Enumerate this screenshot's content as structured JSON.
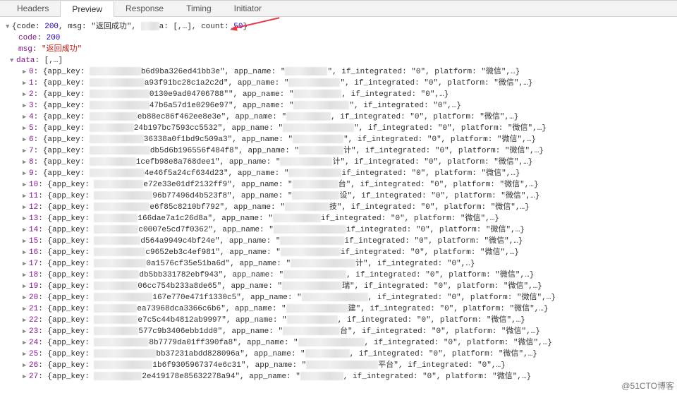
{
  "tabs": [
    {
      "label": "Headers",
      "active": false
    },
    {
      "label": "Preview",
      "active": true
    },
    {
      "label": "Response",
      "active": false
    },
    {
      "label": "Timing",
      "active": false
    },
    {
      "label": "Initiator",
      "active": false
    }
  ],
  "summary": {
    "prefix": "{code: ",
    "code": "200",
    "msg_label": ", msg: \"",
    "msg": "返回成功",
    "msg_suffix": "\", ",
    "mid_redact_text": "a: [,…]",
    "count_label": ", count: ",
    "count": "50",
    "suffix": "}"
  },
  "meta": {
    "code_key": "code",
    "code_val": "200",
    "msg_key": "msg",
    "msg_val": "\"返回成功\"",
    "data_key": "data",
    "data_val": "[,…]"
  },
  "items": [
    {
      "i": 0,
      "hash": "b6d9ba326ed41bb3e",
      "tail": "\", if_integrated: \"0\", platform: \"微信\",…}"
    },
    {
      "i": 1,
      "hash": "a93f91bc28c1a2c2d",
      "tail": "\", if_integrated: \"0\", platform: \"微信\",…}"
    },
    {
      "i": 2,
      "hash": "0130e9ad04706788\"",
      "tail": ", if_integrated: \"0\",…}"
    },
    {
      "i": 3,
      "hash": "47b6a57d1e0296e97",
      "tail": "\", if_integrated: \"0\",…}"
    },
    {
      "i": 4,
      "hash": "eb88ec86f462ee8e3e",
      "tail": ", if_integrated: \"0\", platform: \"微信\",…}"
    },
    {
      "i": 5,
      "hash": "24b197bc7593cc5532",
      "tail": "\", if_integrated: \"0\", platform: \"微信\",…}"
    },
    {
      "i": 6,
      "hash": "36338a0f1bd9c509a3",
      "tail": "\", if_integrated: \"0\", platform: \"微信\",…}"
    },
    {
      "i": 7,
      "hash": "db5d6b196556f484f8",
      "tail": "计\", if_integrated: \"0\", platform: \"微信\",…}"
    },
    {
      "i": 8,
      "hash": "1cefb98e8a768dee1",
      "tail": "计\", if_integrated: \"0\", platform: \"微信\",…}"
    },
    {
      "i": 9,
      "hash": "4e46f5a24cf634d23",
      "tail": "if_integrated: \"0\", platform: \"微信\",…}"
    },
    {
      "i": 10,
      "hash": "e72e33e01df2132ff9",
      "tail": "台\", if_integrated: \"0\", platform: \"微信\",…}"
    },
    {
      "i": 11,
      "hash": "96b77496d4b523f8",
      "tail": "设\", if_integrated: \"0\", platform: \"微信\",…}"
    },
    {
      "i": 12,
      "hash": "e6f85c8210bf792",
      "tail": "技\", if_integrated: \"0\", platform: \"微信\",…}"
    },
    {
      "i": 13,
      "hash": "166dae7a1c26d8a",
      "tail": "if_integrated: \"0\", platform: \"微信\",…}"
    },
    {
      "i": 14,
      "hash": "c0007e5cd7f0362",
      "tail": "if_integrated: \"0\", platform: \"微信\",…}"
    },
    {
      "i": 15,
      "hash": "d564a9949c4bf24e",
      "tail": "if_integrated: \"0\", platform: \"微信\",…}"
    },
    {
      "i": 16,
      "hash": "c9652eb3c4ef981",
      "tail": "if_integrated: \"0\", platform: \"微信\",…}"
    },
    {
      "i": 17,
      "hash": "0a1576cf35e51ba6d",
      "tail": "计\", if_integrated: \"0\",…}"
    },
    {
      "i": 18,
      "hash": "db5bb331782ebf943",
      "tail": ", if_integrated: \"0\", platform: \"微信\",…}"
    },
    {
      "i": 19,
      "hash": "06cc754b233a8de65",
      "tail": "瑞\", if_integrated: \"0\", platform: \"微信\",…}"
    },
    {
      "i": 20,
      "hash": "167e770e471f1330c5",
      "tail": ", if_integrated: \"0\", platform: \"微信\",…}"
    },
    {
      "i": 21,
      "hash": "ea73968dca3366c6b6",
      "tail": "建\", if_integrated: \"0\", platform: \"微信\",…}"
    },
    {
      "i": 22,
      "hash": "e7c5c44b4812ab9997",
      "tail": ", if_integrated: \"0\", platform: \"微信\",…}"
    },
    {
      "i": 23,
      "hash": "577c9b3406ebb1dd0",
      "tail": "台\", if_integrated: \"0\", platform: \"微信\",…}"
    },
    {
      "i": 24,
      "hash": "8b7779da01ff390fa8",
      "tail": ", if_integrated: \"0\", platform: \"微信\",…}"
    },
    {
      "i": 25,
      "hash": "bb37231abdd828096a",
      "tail": ", if_integrated: \"0\", platform: \"微信\",…}"
    },
    {
      "i": 26,
      "hash": "1b6f9305967374e6c31",
      "tail": "平台\", if_integrated: \"0\",…}"
    },
    {
      "i": 27,
      "hash": "2e419178e85632278a94",
      "tail": ", if_integrated: \"0\", platform: \"微信\",…}"
    }
  ],
  "labels": {
    "app_key": "{app_key: ",
    "app_name": ", app_name: \"",
    "close": "\""
  },
  "watermark": "@51CTO博客"
}
